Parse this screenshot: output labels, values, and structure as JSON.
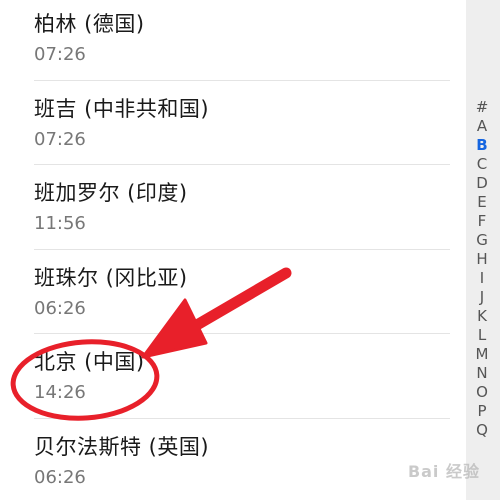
{
  "cities": [
    {
      "name": "柏林 (德国)",
      "time": "07:26"
    },
    {
      "name": "班吉 (中非共和国)",
      "time": "07:26"
    },
    {
      "name": "班加罗尔 (印度)",
      "time": "11:56"
    },
    {
      "name": "班珠尔 (冈比亚)",
      "time": "06:26"
    },
    {
      "name": "北京 (中国)",
      "time": "14:26"
    },
    {
      "name": "贝尔法斯特 (英国)",
      "time": "06:26"
    }
  ],
  "index_letters": [
    "#",
    "A",
    "B",
    "C",
    "D",
    "E",
    "F",
    "G",
    "H",
    "I",
    "J",
    "K",
    "L",
    "M",
    "N",
    "O",
    "P",
    "Q"
  ],
  "active_index": "B",
  "annotation": {
    "color": "#e8202a",
    "highlighted_city": "北京 (中国)"
  },
  "watermark": "Bai 经验"
}
